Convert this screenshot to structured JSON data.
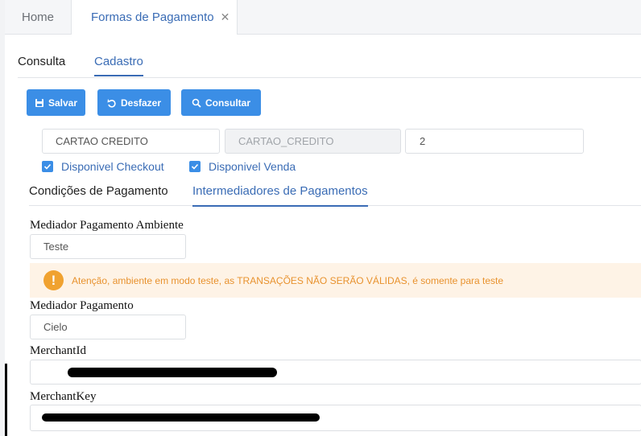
{
  "tabs": {
    "home": "Home",
    "active": "Formas de Pagamento",
    "close_glyph": "✕"
  },
  "subtabs": {
    "consulta": "Consulta",
    "cadastro": "Cadastro"
  },
  "toolbar": {
    "salvar": "Salvar",
    "desfazer": "Desfazer",
    "consultar": "Consultar"
  },
  "form": {
    "nome": "CARTAO CREDITO",
    "codigo": "CARTAO_CREDITO",
    "numero": "2",
    "disponivel_checkout": "Disponivel Checkout",
    "disponivel_venda": "Disponivel Venda"
  },
  "condition_tabs": {
    "condicoes": "Condições de Pagamento",
    "intermediadores": "Intermediadores de Pagamentos"
  },
  "intermediadores": {
    "ambiente_label": "Mediador Pagamento Ambiente",
    "ambiente_value": "Teste",
    "alert_icon": "!",
    "alert_text": "Atenção, ambiente em modo teste, as TRANSAÇÕES NÃO SERÃO VÁLIDAS, é somente para teste",
    "mediador_label": "Mediador Pagamento",
    "mediador_value": "Cielo",
    "merchant_id_label": "MerchantId",
    "merchant_key_label": "MerchantKey"
  },
  "colors": {
    "primary": "#3b8ee6",
    "accent_text": "#3a6cb5",
    "warning_bg": "#fef3e6",
    "warning_icon": "#f0a230",
    "warning_text": "#e8922e"
  }
}
